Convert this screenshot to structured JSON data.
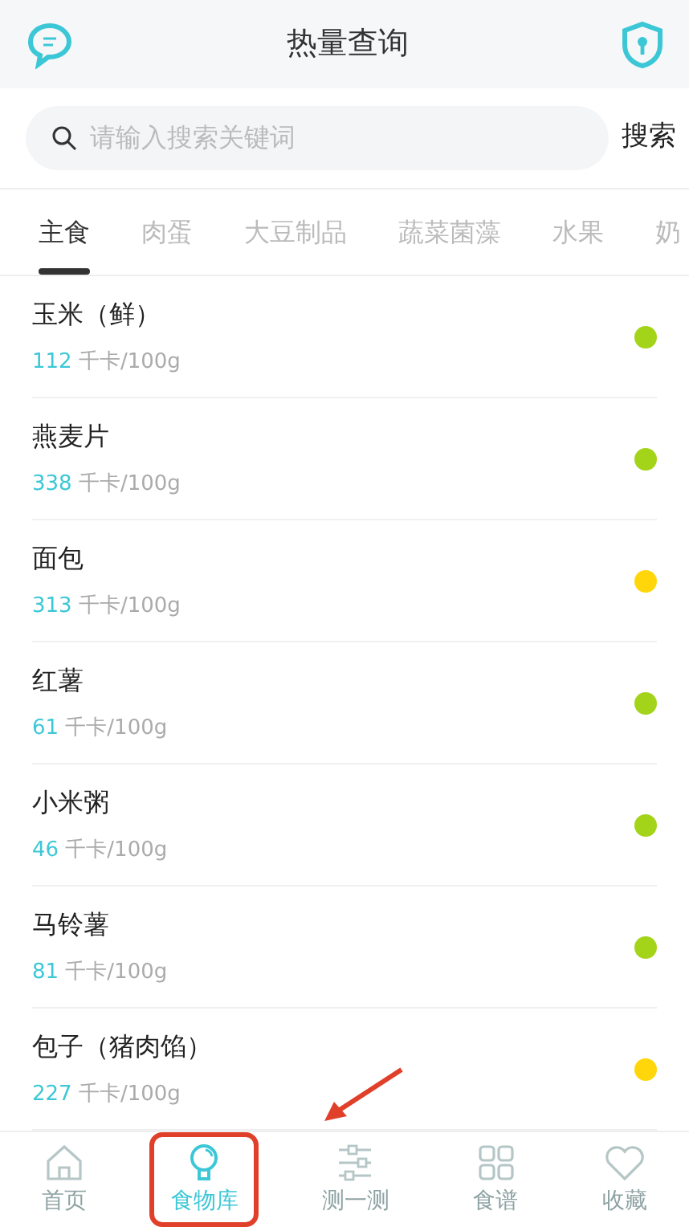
{
  "header": {
    "title": "热量查询"
  },
  "search": {
    "placeholder": "请输入搜索关键词",
    "button": "搜索"
  },
  "tabs": [
    {
      "label": "主食",
      "selected": true
    },
    {
      "label": "肉蛋",
      "selected": false
    },
    {
      "label": "大豆制品",
      "selected": false
    },
    {
      "label": "蔬菜菌藻",
      "selected": false
    },
    {
      "label": "水果",
      "selected": false
    },
    {
      "label": "奶",
      "selected": false
    }
  ],
  "foods": [
    {
      "name": "玉米（鲜）",
      "kcal": "112",
      "unit": "千卡/100g",
      "color": "#a3d41a"
    },
    {
      "name": "燕麦片",
      "kcal": "338",
      "unit": "千卡/100g",
      "color": "#a3d41a"
    },
    {
      "name": "面包",
      "kcal": "313",
      "unit": "千卡/100g",
      "color": "#ffd60a"
    },
    {
      "name": "红薯",
      "kcal": "61",
      "unit": "千卡/100g",
      "color": "#a3d41a"
    },
    {
      "name": "小米粥",
      "kcal": "46",
      "unit": "千卡/100g",
      "color": "#a3d41a"
    },
    {
      "name": "马铃薯",
      "kcal": "81",
      "unit": "千卡/100g",
      "color": "#a3d41a"
    },
    {
      "name": "包子（猪肉馅）",
      "kcal": "227",
      "unit": "千卡/100g",
      "color": "#ffd60a"
    }
  ],
  "bottom_nav": [
    {
      "label": "首页",
      "kind": "home",
      "selected": false,
      "highlighted": false
    },
    {
      "label": "食物库",
      "kind": "bulb",
      "selected": true,
      "highlighted": true
    },
    {
      "label": "测一测",
      "kind": "sliders",
      "selected": false,
      "highlighted": false
    },
    {
      "label": "食谱",
      "kind": "grid",
      "selected": false,
      "highlighted": false
    },
    {
      "label": "收藏",
      "kind": "heart",
      "selected": false,
      "highlighted": false
    }
  ]
}
